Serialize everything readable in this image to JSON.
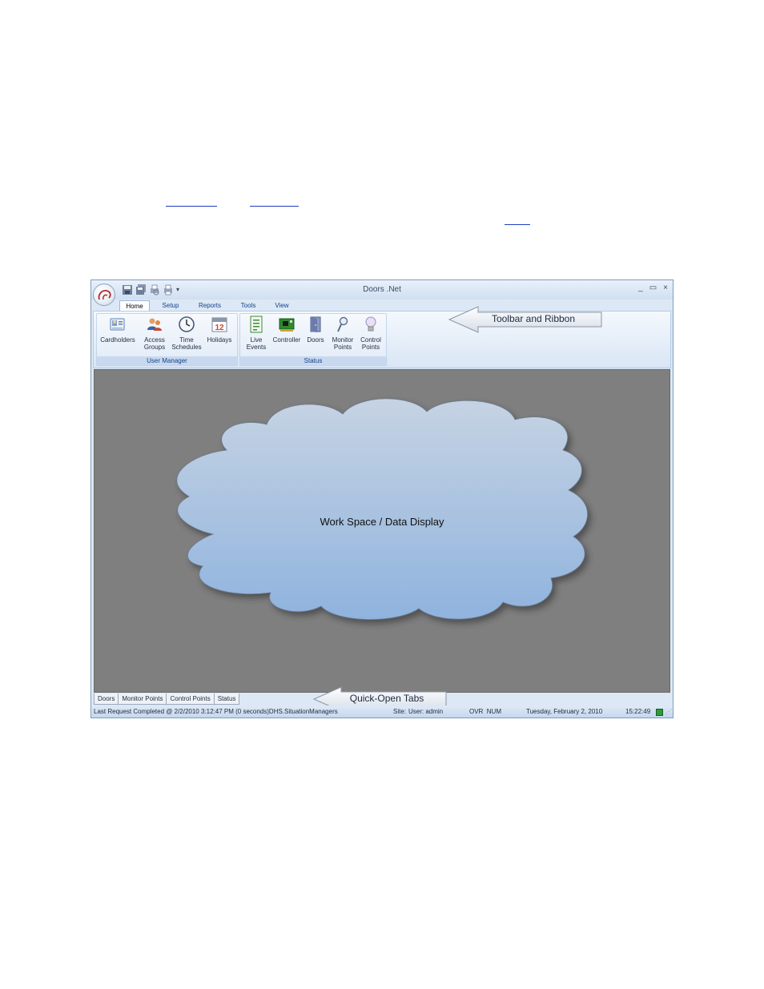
{
  "window": {
    "title": "Doors .Net",
    "controls": {
      "minimize": "_",
      "maximize": "▭",
      "close": "×"
    }
  },
  "ribbon": {
    "tabs": [
      "Home",
      "Setup",
      "Reports",
      "Tools",
      "View"
    ],
    "active_tab": "Home",
    "groups": [
      {
        "label": "User Manager",
        "buttons": [
          {
            "label": "Cardholders",
            "icon": "cardholders-icon"
          },
          {
            "label": "Access\nGroups",
            "icon": "access-groups-icon"
          },
          {
            "label": "Time\nSchedules",
            "icon": "clock-icon"
          },
          {
            "label": "Holidays",
            "icon": "calendar-icon",
            "icon_text": "12"
          }
        ]
      },
      {
        "label": "Status",
        "buttons": [
          {
            "label": "Live\nEvents",
            "icon": "live-events-icon"
          },
          {
            "label": "Controller",
            "icon": "controller-board-icon"
          },
          {
            "label": "Doors",
            "icon": "door-icon"
          },
          {
            "label": "Monitor\nPoints",
            "icon": "monitor-point-icon"
          },
          {
            "label": "Control\nPoints",
            "icon": "lightbulb-icon"
          }
        ]
      }
    ]
  },
  "callouts": {
    "toolbar": "Toolbar and Ribbon",
    "quick_tabs": "Quick-Open Tabs",
    "workspace": "Work Space / Data Display"
  },
  "quick_tabs": [
    "Doors",
    "Monitor Points",
    "Control Points",
    "Status"
  ],
  "status_bar": {
    "last_request": "Last Request Completed @ 2/2/2010 3:12:47 PM (0 seconds)DHS.SituationManagers",
    "site": "Site:",
    "user": "User: admin",
    "ovr_num": "OVR  NUM",
    "date": "Tuesday, February 2, 2010",
    "time": "15:22:49"
  },
  "colors": {
    "cloud_top": "#c6d3e3",
    "cloud_bottom": "#8fb3de",
    "workspace": "#7f7f7f",
    "accent": "#15428b"
  }
}
